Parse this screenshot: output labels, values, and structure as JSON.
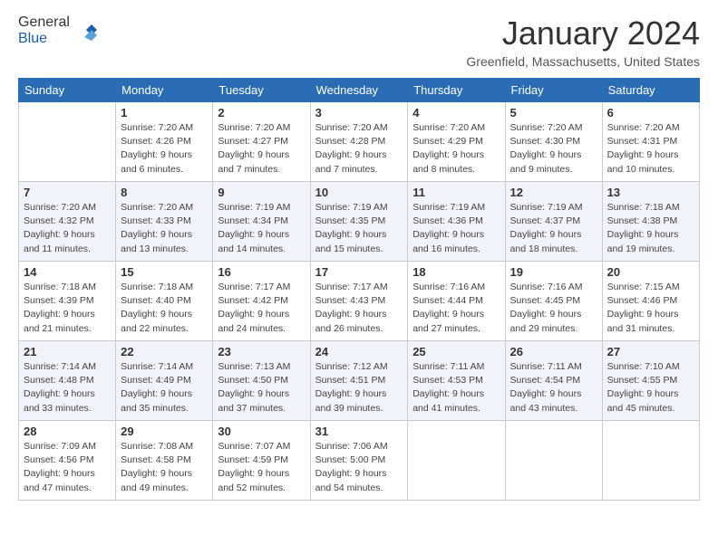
{
  "header": {
    "logo_general": "General",
    "logo_blue": "Blue",
    "month": "January 2024",
    "location": "Greenfield, Massachusetts, United States"
  },
  "days_of_week": [
    "Sunday",
    "Monday",
    "Tuesday",
    "Wednesday",
    "Thursday",
    "Friday",
    "Saturday"
  ],
  "weeks": [
    [
      {
        "day": "",
        "sunrise": "",
        "sunset": "",
        "daylight": ""
      },
      {
        "day": "1",
        "sunrise": "Sunrise: 7:20 AM",
        "sunset": "Sunset: 4:26 PM",
        "daylight": "Daylight: 9 hours and 6 minutes."
      },
      {
        "day": "2",
        "sunrise": "Sunrise: 7:20 AM",
        "sunset": "Sunset: 4:27 PM",
        "daylight": "Daylight: 9 hours and 7 minutes."
      },
      {
        "day": "3",
        "sunrise": "Sunrise: 7:20 AM",
        "sunset": "Sunset: 4:28 PM",
        "daylight": "Daylight: 9 hours and 7 minutes."
      },
      {
        "day": "4",
        "sunrise": "Sunrise: 7:20 AM",
        "sunset": "Sunset: 4:29 PM",
        "daylight": "Daylight: 9 hours and 8 minutes."
      },
      {
        "day": "5",
        "sunrise": "Sunrise: 7:20 AM",
        "sunset": "Sunset: 4:30 PM",
        "daylight": "Daylight: 9 hours and 9 minutes."
      },
      {
        "day": "6",
        "sunrise": "Sunrise: 7:20 AM",
        "sunset": "Sunset: 4:31 PM",
        "daylight": "Daylight: 9 hours and 10 minutes."
      }
    ],
    [
      {
        "day": "7",
        "sunrise": "Sunrise: 7:20 AM",
        "sunset": "Sunset: 4:32 PM",
        "daylight": "Daylight: 9 hours and 11 minutes."
      },
      {
        "day": "8",
        "sunrise": "Sunrise: 7:20 AM",
        "sunset": "Sunset: 4:33 PM",
        "daylight": "Daylight: 9 hours and 13 minutes."
      },
      {
        "day": "9",
        "sunrise": "Sunrise: 7:19 AM",
        "sunset": "Sunset: 4:34 PM",
        "daylight": "Daylight: 9 hours and 14 minutes."
      },
      {
        "day": "10",
        "sunrise": "Sunrise: 7:19 AM",
        "sunset": "Sunset: 4:35 PM",
        "daylight": "Daylight: 9 hours and 15 minutes."
      },
      {
        "day": "11",
        "sunrise": "Sunrise: 7:19 AM",
        "sunset": "Sunset: 4:36 PM",
        "daylight": "Daylight: 9 hours and 16 minutes."
      },
      {
        "day": "12",
        "sunrise": "Sunrise: 7:19 AM",
        "sunset": "Sunset: 4:37 PM",
        "daylight": "Daylight: 9 hours and 18 minutes."
      },
      {
        "day": "13",
        "sunrise": "Sunrise: 7:18 AM",
        "sunset": "Sunset: 4:38 PM",
        "daylight": "Daylight: 9 hours and 19 minutes."
      }
    ],
    [
      {
        "day": "14",
        "sunrise": "Sunrise: 7:18 AM",
        "sunset": "Sunset: 4:39 PM",
        "daylight": "Daylight: 9 hours and 21 minutes."
      },
      {
        "day": "15",
        "sunrise": "Sunrise: 7:18 AM",
        "sunset": "Sunset: 4:40 PM",
        "daylight": "Daylight: 9 hours and 22 minutes."
      },
      {
        "day": "16",
        "sunrise": "Sunrise: 7:17 AM",
        "sunset": "Sunset: 4:42 PM",
        "daylight": "Daylight: 9 hours and 24 minutes."
      },
      {
        "day": "17",
        "sunrise": "Sunrise: 7:17 AM",
        "sunset": "Sunset: 4:43 PM",
        "daylight": "Daylight: 9 hours and 26 minutes."
      },
      {
        "day": "18",
        "sunrise": "Sunrise: 7:16 AM",
        "sunset": "Sunset: 4:44 PM",
        "daylight": "Daylight: 9 hours and 27 minutes."
      },
      {
        "day": "19",
        "sunrise": "Sunrise: 7:16 AM",
        "sunset": "Sunset: 4:45 PM",
        "daylight": "Daylight: 9 hours and 29 minutes."
      },
      {
        "day": "20",
        "sunrise": "Sunrise: 7:15 AM",
        "sunset": "Sunset: 4:46 PM",
        "daylight": "Daylight: 9 hours and 31 minutes."
      }
    ],
    [
      {
        "day": "21",
        "sunrise": "Sunrise: 7:14 AM",
        "sunset": "Sunset: 4:48 PM",
        "daylight": "Daylight: 9 hours and 33 minutes."
      },
      {
        "day": "22",
        "sunrise": "Sunrise: 7:14 AM",
        "sunset": "Sunset: 4:49 PM",
        "daylight": "Daylight: 9 hours and 35 minutes."
      },
      {
        "day": "23",
        "sunrise": "Sunrise: 7:13 AM",
        "sunset": "Sunset: 4:50 PM",
        "daylight": "Daylight: 9 hours and 37 minutes."
      },
      {
        "day": "24",
        "sunrise": "Sunrise: 7:12 AM",
        "sunset": "Sunset: 4:51 PM",
        "daylight": "Daylight: 9 hours and 39 minutes."
      },
      {
        "day": "25",
        "sunrise": "Sunrise: 7:11 AM",
        "sunset": "Sunset: 4:53 PM",
        "daylight": "Daylight: 9 hours and 41 minutes."
      },
      {
        "day": "26",
        "sunrise": "Sunrise: 7:11 AM",
        "sunset": "Sunset: 4:54 PM",
        "daylight": "Daylight: 9 hours and 43 minutes."
      },
      {
        "day": "27",
        "sunrise": "Sunrise: 7:10 AM",
        "sunset": "Sunset: 4:55 PM",
        "daylight": "Daylight: 9 hours and 45 minutes."
      }
    ],
    [
      {
        "day": "28",
        "sunrise": "Sunrise: 7:09 AM",
        "sunset": "Sunset: 4:56 PM",
        "daylight": "Daylight: 9 hours and 47 minutes."
      },
      {
        "day": "29",
        "sunrise": "Sunrise: 7:08 AM",
        "sunset": "Sunset: 4:58 PM",
        "daylight": "Daylight: 9 hours and 49 minutes."
      },
      {
        "day": "30",
        "sunrise": "Sunrise: 7:07 AM",
        "sunset": "Sunset: 4:59 PM",
        "daylight": "Daylight: 9 hours and 52 minutes."
      },
      {
        "day": "31",
        "sunrise": "Sunrise: 7:06 AM",
        "sunset": "Sunset: 5:00 PM",
        "daylight": "Daylight: 9 hours and 54 minutes."
      },
      {
        "day": "",
        "sunrise": "",
        "sunset": "",
        "daylight": ""
      },
      {
        "day": "",
        "sunrise": "",
        "sunset": "",
        "daylight": ""
      },
      {
        "day": "",
        "sunrise": "",
        "sunset": "",
        "daylight": ""
      }
    ]
  ]
}
